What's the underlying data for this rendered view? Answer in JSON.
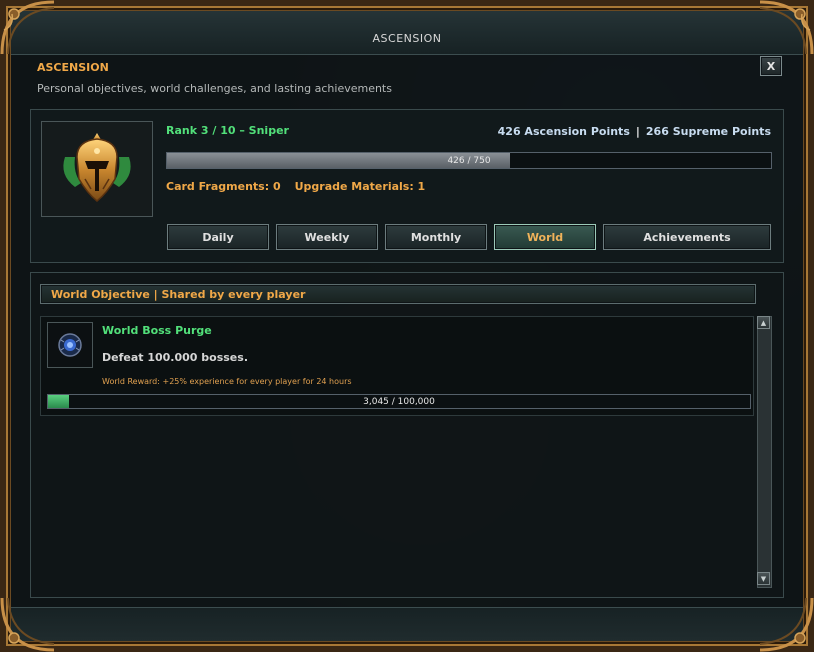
{
  "window": {
    "title": "ASCENSION"
  },
  "header": {
    "title": "ASCENSION",
    "subtitle": "Personal objectives, world challenges, and lasting achievements",
    "close_label": "X"
  },
  "rank": {
    "text": "Rank 3 / 10  –  Sniper",
    "ascension_points": "426 Ascension Points",
    "separator": "|",
    "supreme_points": "266 Supreme Points",
    "progress_label": "426 / 750",
    "progress_fraction": 0.568,
    "card_fragments": "Card Fragments: 0",
    "upgrade_materials": "Upgrade Materials: 1"
  },
  "tabs": [
    {
      "label": "Daily",
      "active": false
    },
    {
      "label": "Weekly",
      "active": false
    },
    {
      "label": "Monthly",
      "active": false
    },
    {
      "label": "World",
      "active": true
    },
    {
      "label": "Achievements",
      "active": false
    }
  ],
  "section": {
    "header": "World Objective  |  Shared by every player"
  },
  "objective": {
    "title": "World Boss Purge",
    "description": "Defeat 100.000 bosses.",
    "reward": "World Reward: +25% experience for every player for 24 hours",
    "progress_label": "3,045 / 100,000",
    "progress_fraction": 0.03045
  },
  "scrollbar": {
    "up_glyph": "▲",
    "down_glyph": "▼"
  },
  "colors": {
    "accent_orange": "#f0a848",
    "accent_green": "#52e07a",
    "points_blue": "#c8dcf0",
    "gold_frame": "#a87836"
  },
  "icons": {
    "rank_emblem": "golden-helmet-icon",
    "objective": "boss-orb-icon"
  }
}
